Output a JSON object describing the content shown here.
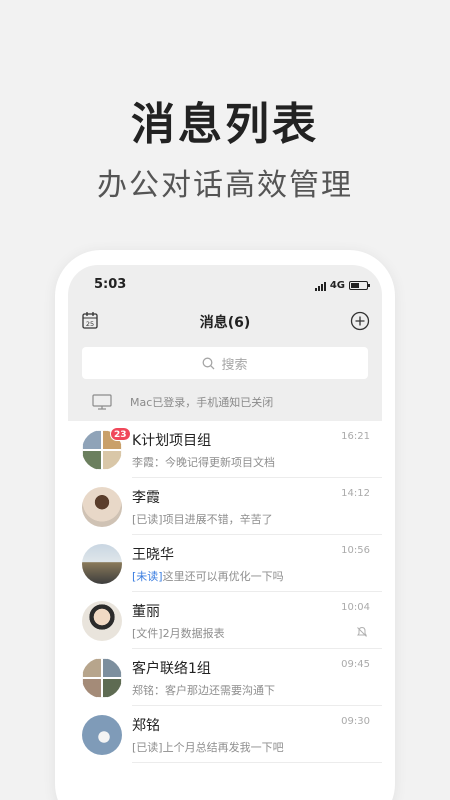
{
  "headline": "消息列表",
  "subline": "办公对话高效管理",
  "status": {
    "time": "5:03",
    "network": "4G",
    "battery_level": 0.55
  },
  "navbar": {
    "title": "消息(6)",
    "left_icon": "calendar-icon",
    "right_icon": "plus-circle-icon"
  },
  "search": {
    "placeholder": "搜索"
  },
  "notice": {
    "text": "Mac已登录，手机通知已关闭",
    "icon": "monitor-icon"
  },
  "colors": {
    "badge": "#f0485a",
    "unread_tag": "#3a7de0",
    "top_bg": "#eeeeee"
  },
  "conversations": [
    {
      "name": "K计划项目组",
      "preview": "李霞：今晚记得更新项目文档",
      "tag": "",
      "time": "16:21",
      "badge": "23",
      "muted": false
    },
    {
      "name": "李霞",
      "preview": "项目进展不错，辛苦了",
      "tag": "[已读]",
      "time": "14:12",
      "badge": "",
      "muted": false
    },
    {
      "name": "王晓华",
      "preview": "这里还可以再优化一下吗",
      "tag": "[未读]",
      "time": "10:56",
      "badge": "",
      "muted": false
    },
    {
      "name": "董丽",
      "preview": "2月数据报表",
      "tag": "[文件]",
      "time": "10:04",
      "badge": "",
      "muted": true
    },
    {
      "name": "客户联络1组",
      "preview": "郑铭：客户那边还需要沟通下",
      "tag": "",
      "time": "09:45",
      "badge": "",
      "muted": false
    },
    {
      "name": "郑铭",
      "preview": "上个月总结再发我一下吧",
      "tag": "[已读]",
      "time": "09:30",
      "badge": "",
      "muted": false
    }
  ]
}
